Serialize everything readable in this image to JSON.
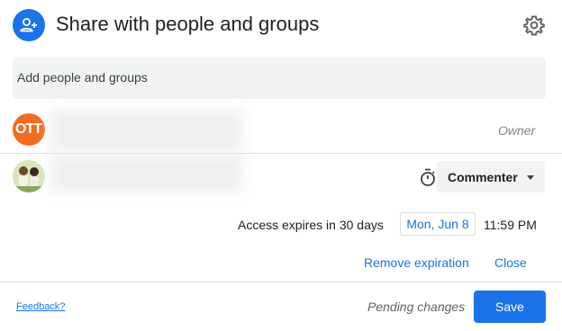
{
  "header": {
    "title": "Share with people and groups",
    "icon": "person-add-icon",
    "settings_icon": "gear-icon"
  },
  "add_people": {
    "placeholder": "Add people and groups"
  },
  "people": [
    {
      "avatar_text": "OTT",
      "avatar_color": "#f26b21",
      "role": "Owner"
    },
    {
      "role": "Commenter",
      "expiry_icon": "timer-icon"
    }
  ],
  "expiration": {
    "text": "Access expires in 30 days",
    "date": "Mon, Jun 8",
    "time": "11:59 PM",
    "remove_label": "Remove expiration",
    "close_label": "Close"
  },
  "footer": {
    "feedback_label": "Feedback?",
    "pending_label": "Pending changes",
    "save_label": "Save"
  },
  "colors": {
    "accent": "#1a73e8",
    "input_bg": "#f1f3f4",
    "divider": "#dadce0"
  }
}
